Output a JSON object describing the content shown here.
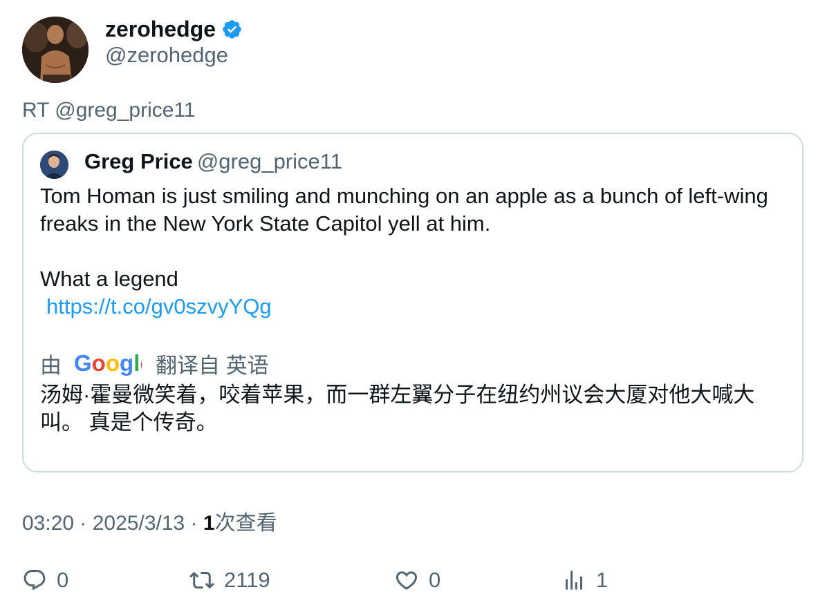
{
  "author": {
    "display_name": "zerohedge",
    "handle": "@zerohedge",
    "verified_icon": "verified-badge-icon"
  },
  "retweet_line": "RT @greg_price11",
  "quoted": {
    "display_name": "Greg Price",
    "handle": "@greg_price11",
    "text_line1": "Tom Homan is just smiling and munching on an apple as a bunch of left-wing freaks in the New York State Capitol yell at him.",
    "text_line2": "What a legend",
    "link": "https://t.co/gv0szvyYQg",
    "translate_prefix": "由",
    "translate_brand": "Google",
    "translate_suffix": "翻译自 英语",
    "translation": "汤姆·霍曼微笑着，咬着苹果，而一群左翼分子在纽约州议会大厦对他大喊大叫。 真是个传奇。"
  },
  "meta": {
    "time": "03:20",
    "sep1": " · ",
    "date": "2025/3/13",
    "sep2": " · ",
    "views_count": "1",
    "views_label": "次查看"
  },
  "actions": {
    "replies": "0",
    "retweets": "2119",
    "likes": "0",
    "views": "1"
  },
  "colors": {
    "accent": "#1d9bf0",
    "secondary_text": "#536471",
    "primary_text": "#0f1419",
    "border": "#cfd9de"
  }
}
